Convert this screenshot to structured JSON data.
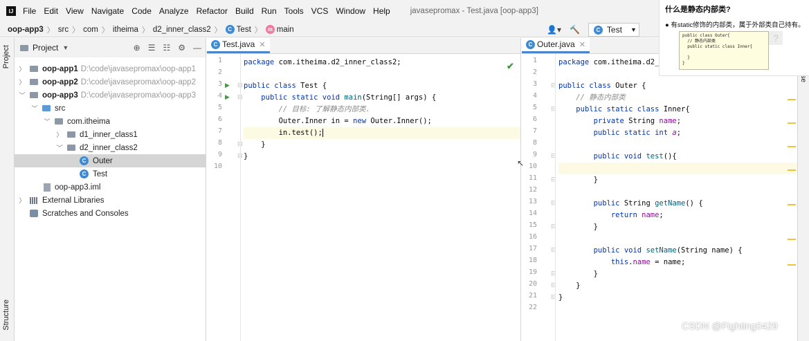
{
  "menubar": {
    "logo": "IJ",
    "items": [
      "File",
      "Edit",
      "View",
      "Navigate",
      "Code",
      "Analyze",
      "Refactor",
      "Build",
      "Run",
      "Tools",
      "VCS",
      "Window",
      "Help"
    ],
    "title": "javasepromax - Test.java [oop-app3]"
  },
  "breadcrumb": [
    "oop-app3",
    "src",
    "com",
    "itheima",
    "d2_inner_class2",
    "Test",
    "main"
  ],
  "run_config": "Test",
  "side_tabs": {
    "project": "Project",
    "structure": "Structure"
  },
  "project_panel": {
    "header": "Project",
    "tree": [
      {
        "label": "oop-app1",
        "path": "D:\\code\\javasepromax\\oop-app1"
      },
      {
        "label": "oop-app2",
        "path": "D:\\code\\javasepromax\\oop-app2"
      },
      {
        "label": "oop-app3",
        "path": "D:\\code\\javasepromax\\oop-app3"
      },
      {
        "label": "src"
      },
      {
        "label": "com.itheima"
      },
      {
        "label": "d1_inner_class1"
      },
      {
        "label": "d2_inner_class2"
      },
      {
        "label": "Outer"
      },
      {
        "label": "Test"
      },
      {
        "label": "oop-app3.iml"
      },
      {
        "label": "External Libraries"
      },
      {
        "label": "Scratches and Consoles"
      }
    ]
  },
  "left_editor": {
    "tab": "Test.java",
    "lines": [
      "1",
      "2",
      "3",
      "4",
      "5",
      "6",
      "7",
      "8",
      "9",
      "10"
    ]
  },
  "right_editor": {
    "tab": "Outer.java",
    "lines": [
      "1",
      "2",
      "3",
      "4",
      "5",
      "6",
      "7",
      "8",
      "9",
      "10",
      "11",
      "12",
      "13",
      "14",
      "15",
      "16",
      "17",
      "18",
      "19",
      "20",
      "21",
      "22"
    ]
  },
  "popup": {
    "title": "什么是静态内部类?",
    "bullet": "有static修饰的内部类，属于外部类自己持有。",
    "code": "public class Outer{\n  // 静态内部类\n  public static class Inner{\n\n  }\n}",
    "help_glyph": "?"
  },
  "edge_text": "ase",
  "watermark": "CSDN @Fighting0429"
}
